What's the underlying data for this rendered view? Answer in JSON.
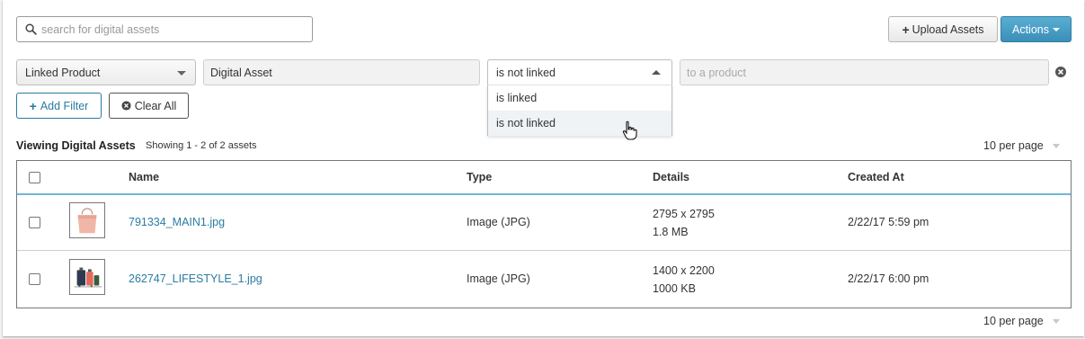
{
  "search": {
    "placeholder": "search for digital assets",
    "value": ""
  },
  "toolbar": {
    "upload_label": "Upload Assets",
    "actions_label": "Actions"
  },
  "filter": {
    "field": "Linked Product",
    "field_value": "Digital Asset",
    "operator": "is not linked",
    "operator_options": [
      "is linked",
      "is not linked"
    ],
    "value_placeholder": "to a product"
  },
  "filter_buttons": {
    "add_label": "Add Filter",
    "clear_label": "Clear All"
  },
  "list": {
    "title": "Viewing Digital Assets",
    "showing": "Showing 1 - 2 of 2 assets",
    "per_page": "10 per page"
  },
  "table": {
    "headers": {
      "name": "Name",
      "type": "Type",
      "details": "Details",
      "created": "Created At"
    },
    "rows": [
      {
        "name": "791334_MAIN1.jpg",
        "type": "Image (JPG)",
        "dimensions": "2795 x 2795",
        "size": "1.8 MB",
        "created": "2/22/17 5:59 pm"
      },
      {
        "name": "262747_LIFESTYLE_1.jpg",
        "type": "Image (JPG)",
        "dimensions": "1400 x 2200",
        "size": "1000 KB",
        "created": "2/22/17 6:00 pm"
      }
    ]
  },
  "colors": {
    "accent": "#2a7ba2",
    "actions_button": "#4a9fc6",
    "header_rule": "#6cb8d8"
  }
}
